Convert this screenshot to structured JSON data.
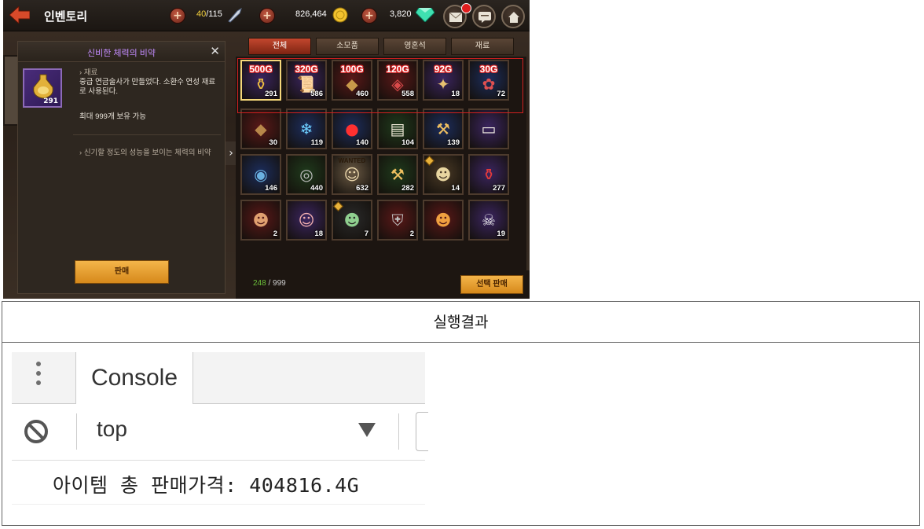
{
  "game": {
    "title": "인벤토리",
    "stamina": "40",
    "stamina_max": "/115",
    "gold": "826,464",
    "gems": "3,820",
    "detail": {
      "title": "신비한 체력의 비약",
      "close": "✕",
      "item_count": "291",
      "category": "재료",
      "desc1": "중급 연금술사가 만들었다. 소환수 연성 재료로 사용된다.",
      "limit": "최대 999개 보유 가능",
      "flavor": "신기할 정도의 성능을 보이는 체력의 비약",
      "sell_label": "판매"
    },
    "tabs": [
      "전체",
      "소모품",
      "영혼석",
      "재료"
    ],
    "row1": [
      {
        "price": "500G",
        "count": "291",
        "icon": "potion-icon",
        "bg": "#3b2560"
      },
      {
        "price": "320G",
        "count": "586",
        "icon": "scroll-icon",
        "bg": "#3b2560"
      },
      {
        "price": "100G",
        "count": "460",
        "icon": "rune-stone-icon",
        "bg": "#5a1818"
      },
      {
        "price": "120G",
        "count": "558",
        "icon": "red-rune-icon",
        "bg": "#5a1818"
      },
      {
        "price": "92G",
        "count": "18",
        "icon": "compass-icon",
        "bg": "#3b2560"
      },
      {
        "price": "30G",
        "count": "72",
        "icon": "bouquet-icon",
        "bg": "#1c2d5c"
      }
    ],
    "row2": [
      {
        "count": "30",
        "icon": "brown-stone-icon",
        "bg": "#5a1818"
      },
      {
        "count": "119",
        "icon": "snowflake-icon",
        "bg": "#1c2d5c"
      },
      {
        "count": "140",
        "icon": "red-orb-icon",
        "bg": "#1c2d5c"
      },
      {
        "count": "104",
        "icon": "parchment-icon",
        "bg": "#1f3a1c"
      },
      {
        "count": "139",
        "icon": "axe-icon",
        "bg": "#1c2d5c"
      },
      {
        "count": "",
        "icon": "bone-card-icon",
        "bg": "#3b2560"
      }
    ],
    "row3": [
      {
        "count": "146",
        "icon": "blue-coin-icon",
        "bg": "#1c2d5c"
      },
      {
        "count": "440",
        "icon": "silver-coin-icon",
        "bg": "#1f3a1c"
      },
      {
        "count": "632",
        "icon": "wanted-poster-icon",
        "bg": "#6b5a44",
        "label": "WANTED"
      },
      {
        "count": "282",
        "icon": "axe-icon",
        "bg": "#1f3a1c"
      },
      {
        "count": "14",
        "icon": "golem-face-icon",
        "bg": "#4a3a26"
      },
      {
        "count": "277",
        "icon": "red-potion-icon",
        "bg": "#3b2560"
      }
    ],
    "row4": [
      {
        "count": "2",
        "icon": "goblin-icon",
        "bg": "#5a1818"
      },
      {
        "count": "18",
        "icon": "pig-face-icon",
        "bg": "#3b2560"
      },
      {
        "count": "7",
        "icon": "green-witch-icon",
        "bg": "#2a2a2a"
      },
      {
        "count": "2",
        "icon": "knight-helmet-icon",
        "bg": "#5a1818"
      },
      {
        "count": "",
        "icon": "fox-beast-icon",
        "bg": "#5a1818"
      },
      {
        "count": "19",
        "icon": "skull-icon",
        "bg": "#3b2560"
      }
    ],
    "capacity_used": "248",
    "capacity_max": " / 999",
    "select_sell_label": "선택 판매"
  },
  "result": {
    "header": "실행결과",
    "console_tab": "Console",
    "context": "top",
    "output": "아이템 총 판매가격: 404816.4G"
  }
}
